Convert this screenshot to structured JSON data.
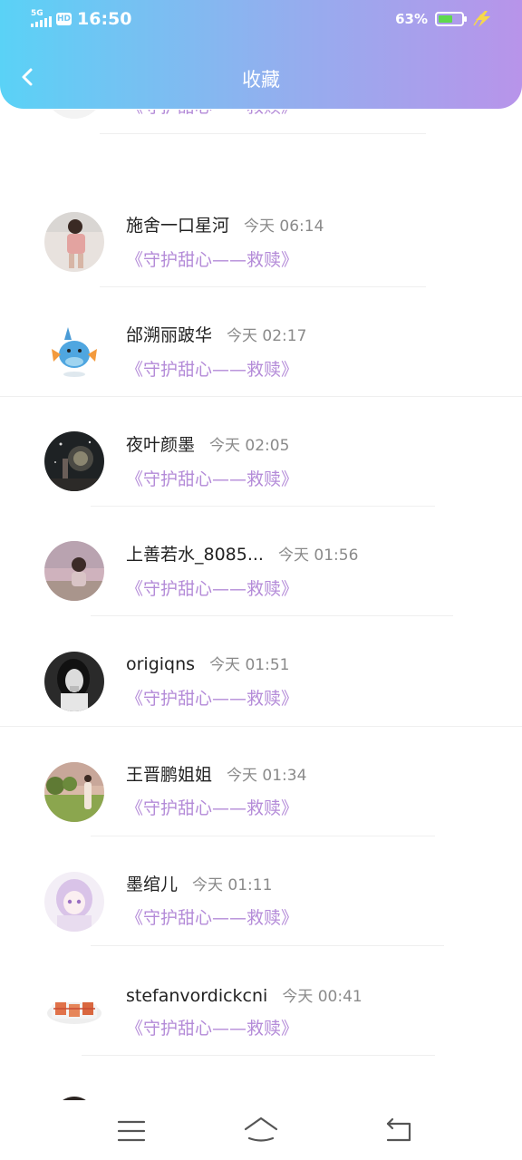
{
  "status_bar": {
    "network": "5G",
    "hd": "HD",
    "time": "16:50",
    "battery_percent_text": "63%",
    "battery_level": 0.63,
    "battery_fill_color": "#5fd94d",
    "icons": [
      "signal-icon",
      "hd-icon",
      "battery-icon",
      "charging-bolt-icon"
    ]
  },
  "header": {
    "title": "收藏",
    "back_icon": "chevron-left-icon",
    "gradient": [
      "#5ad2f6",
      "#b894ea"
    ]
  },
  "favorites": [
    {
      "name": "",
      "time": "",
      "post": "《守护甜心——救赎》"
    },
    {
      "name": "施舍一口星河",
      "time": "今天 06:14",
      "post": "《守护甜心——救赎》"
    },
    {
      "name": "邰溯丽跛华",
      "time": "今天 02:17",
      "post": "《守护甜心——救赎》"
    },
    {
      "name": "夜叶颜墨",
      "time": "今天 02:05",
      "post": "《守护甜心——救赎》"
    },
    {
      "name": "上善若水_8085...",
      "time": "今天 01:56",
      "post": "《守护甜心——救赎》"
    },
    {
      "name": "origiqns",
      "time": "今天 01:51",
      "post": "《守护甜心——救赎》"
    },
    {
      "name": "王晋鹏姐姐",
      "time": "今天 01:34",
      "post": "《守护甜心——救赎》"
    },
    {
      "name": "墨绾儿",
      "time": "今天 01:11",
      "post": "《守护甜心——救赎》"
    },
    {
      "name": "stefanvordickcni",
      "time": "今天 00:41",
      "post": "《守护甜心——救赎》"
    }
  ],
  "colors": {
    "post_link": "#b48bd8",
    "name": "#222222",
    "timestamp": "#8a8a8a"
  },
  "bottom_nav": {
    "icons": [
      "menu-icon",
      "home-icon",
      "back-icon"
    ]
  }
}
